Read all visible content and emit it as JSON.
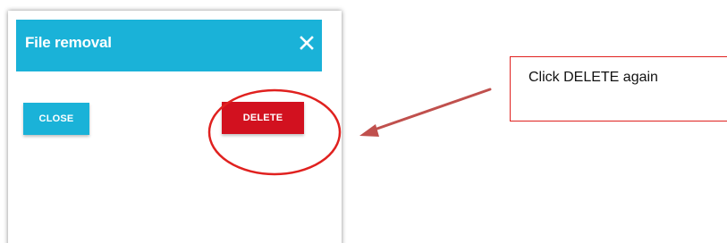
{
  "dialog": {
    "title": "File removal",
    "close_icon": "close-icon",
    "close_button_label": "CLOSE",
    "delete_button_label": "DELETE"
  },
  "annotation": {
    "callout_text": "Click DELETE again",
    "highlight_circle": "red-ellipse",
    "arrow": "red-arrow"
  },
  "colors": {
    "header_bg": "#1ab2d8",
    "close_button_bg": "#1ab2d8",
    "delete_button_bg": "#d2111f",
    "annotation_red": "#e0211f",
    "arrow_color": "#c0504d"
  }
}
